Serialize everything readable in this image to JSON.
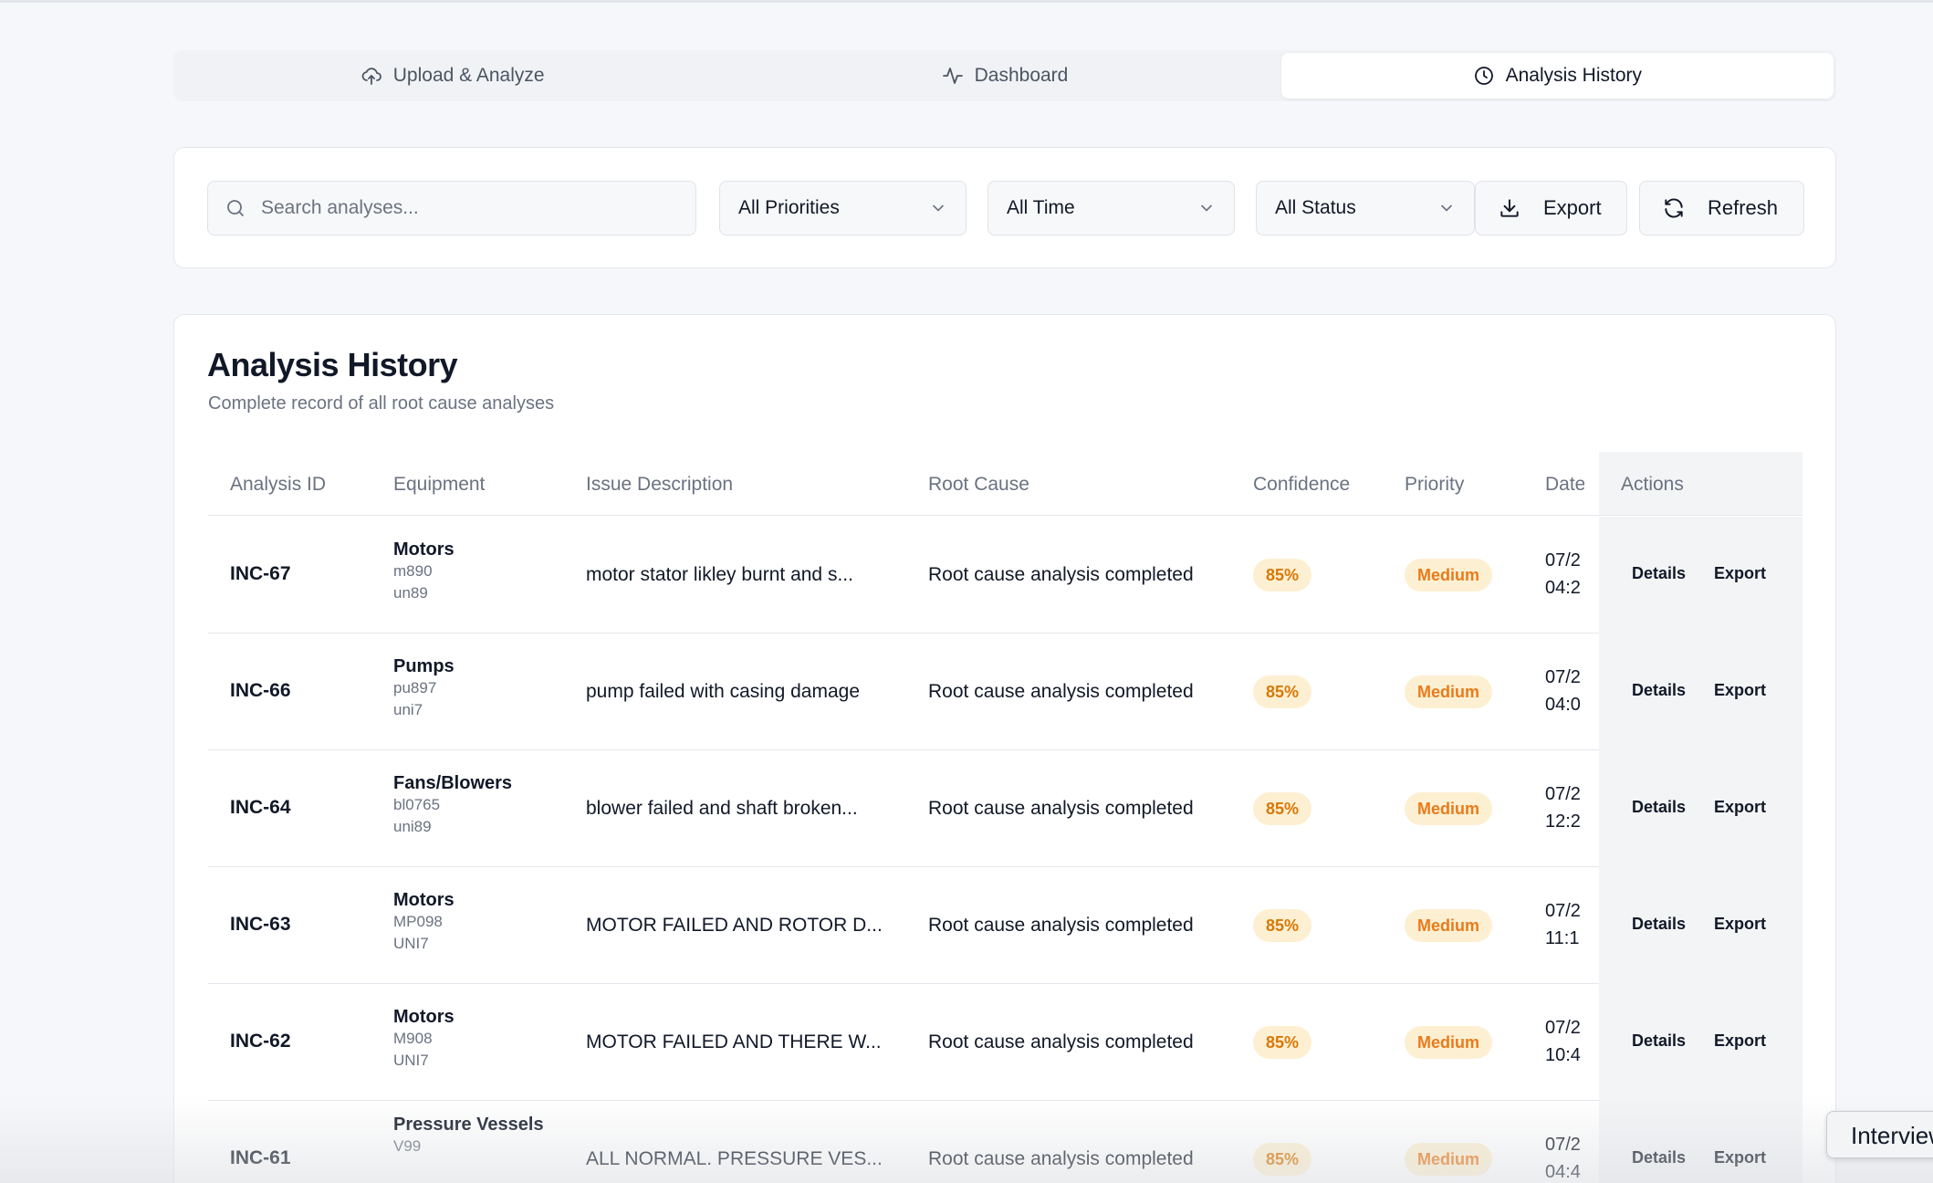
{
  "tabs": [
    {
      "label": "Upload & Analyze",
      "icon": "cloud-upload-icon"
    },
    {
      "label": "Dashboard",
      "icon": "activity-icon"
    },
    {
      "label": "Analysis History",
      "icon": "clock-icon",
      "active": true
    }
  ],
  "filters": {
    "search_placeholder": "Search analyses...",
    "priority": "All Priorities",
    "time": "All Time",
    "status": "All Status",
    "export_label": "Export",
    "refresh_label": "Refresh"
  },
  "history": {
    "title": "Analysis History",
    "subtitle": "Complete record of all root cause analyses",
    "columns": [
      "Analysis ID",
      "Equipment",
      "Issue Description",
      "Root Cause",
      "Confidence",
      "Priority",
      "Date",
      "Actions"
    ],
    "action_details": "Details",
    "action_export": "Export",
    "rows": [
      {
        "id": "INC-67",
        "equipment": "Motors",
        "sub1": "m890",
        "sub2": "un89",
        "issue": "motor stator likley burnt and s...",
        "root_cause": "Root cause analysis completed",
        "confidence": "85%",
        "priority": "Medium",
        "date1": "07/2",
        "date2": "04:2"
      },
      {
        "id": "INC-66",
        "equipment": "Pumps",
        "sub1": "pu897",
        "sub2": "uni7",
        "issue": "pump failed with casing damage",
        "root_cause": "Root cause analysis completed",
        "confidence": "85%",
        "priority": "Medium",
        "date1": "07/2",
        "date2": "04:0"
      },
      {
        "id": "INC-64",
        "equipment": "Fans/Blowers",
        "sub1": "bl0765",
        "sub2": "uni89",
        "issue": "blower failed and shaft broken...",
        "root_cause": "Root cause analysis completed",
        "confidence": "85%",
        "priority": "Medium",
        "date1": "07/2",
        "date2": "12:2"
      },
      {
        "id": "INC-63",
        "equipment": "Motors",
        "sub1": "MP098",
        "sub2": "UNI7",
        "issue": "MOTOR FAILED AND ROTOR D...",
        "root_cause": "Root cause analysis completed",
        "confidence": "85%",
        "priority": "Medium",
        "date1": "07/2",
        "date2": "11:1"
      },
      {
        "id": "INC-62",
        "equipment": "Motors",
        "sub1": "M908",
        "sub2": "UNI7",
        "issue": "MOTOR FAILED AND THERE W...",
        "root_cause": "Root cause analysis completed",
        "confidence": "85%",
        "priority": "Medium",
        "date1": "07/2",
        "date2": "10:4"
      },
      {
        "id": "INC-61",
        "equipment": "Pressure Vessels",
        "sub1": "V99",
        "sub2": "",
        "issue": "ALL NORMAL. PRESSURE VES...",
        "root_cause": "Root cause analysis completed",
        "confidence": "85%",
        "priority": "Medium",
        "date1": "07/2",
        "date2": "04:4"
      }
    ]
  },
  "floating_tab": "Interview",
  "colors": {
    "badge_bg": "#fdf0d2",
    "confidence_text": "#d97706",
    "priority_text": "#ea7a1a",
    "page_bg": "#f6f7fa"
  }
}
